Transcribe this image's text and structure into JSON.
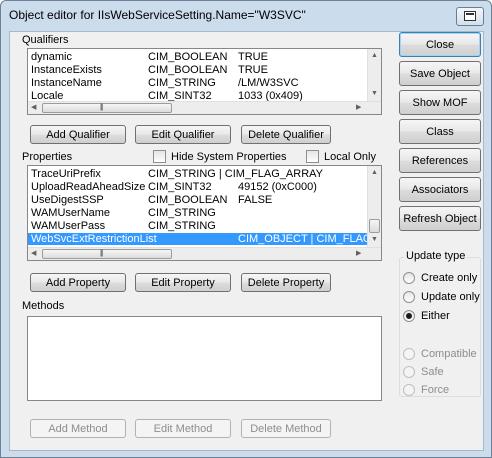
{
  "window": {
    "title": "Object editor for IIsWebServiceSetting.Name=\"W3SVC\""
  },
  "qualifiers": {
    "label": "Qualifiers",
    "rows": [
      {
        "name": "dynamic",
        "type": "CIM_BOOLEAN",
        "value": "TRUE"
      },
      {
        "name": "InstanceExists",
        "type": "CIM_BOOLEAN",
        "value": "TRUE"
      },
      {
        "name": "InstanceName",
        "type": "CIM_STRING",
        "value": "/LM/W3SVC"
      },
      {
        "name": "Locale",
        "type": "CIM_SINT32",
        "value": "1033 (0x409)"
      }
    ],
    "buttons": {
      "add": "Add Qualifier",
      "edit": "Edit Qualifier",
      "delete": "Delete Qualifier"
    }
  },
  "properties": {
    "label": "Properties",
    "hide_system_label": "Hide System Properties",
    "local_only_label": "Local Only",
    "rows": [
      {
        "name": "TraceUriPrefix",
        "type": "CIM_STRING | CIM_FLAG_ARRAY",
        "value": ""
      },
      {
        "name": "UploadReadAheadSize",
        "type": "CIM_SINT32",
        "value": "49152 (0xC000)"
      },
      {
        "name": "UseDigestSSP",
        "type": "CIM_BOOLEAN",
        "value": "FALSE"
      },
      {
        "name": "WAMUserName",
        "type": "CIM_STRING",
        "value": ""
      },
      {
        "name": "WAMUserPass",
        "type": "CIM_STRING",
        "value": ""
      },
      {
        "name": "WebSvcExtRestrictionList",
        "type": "",
        "value": "CIM_OBJECT | CIM_FLAG_ARRAY"
      }
    ],
    "selected_row": "WebSvcExtRestrictionList",
    "buttons": {
      "add": "Add Property",
      "edit": "Edit Property",
      "delete": "Delete Property"
    }
  },
  "methods": {
    "label": "Methods",
    "buttons": {
      "add": "Add Method",
      "edit": "Edit Method",
      "delete": "Delete Method"
    }
  },
  "side_buttons": {
    "close": "Close",
    "save": "Save Object",
    "show_mof": "Show MOF",
    "class": "Class",
    "references": "References",
    "associators": "Associators",
    "refresh": "Refresh Object"
  },
  "update_type": {
    "label": "Update type",
    "options": [
      "Create only",
      "Update only",
      "Either"
    ],
    "selected": "Either",
    "disabled_options": [
      "Compatible",
      "Safe",
      "Force"
    ]
  },
  "colors": {
    "selection": "#3399ff",
    "frame": "#cbdcec"
  },
  "icons": {
    "title_button": "window-restore-icon"
  }
}
